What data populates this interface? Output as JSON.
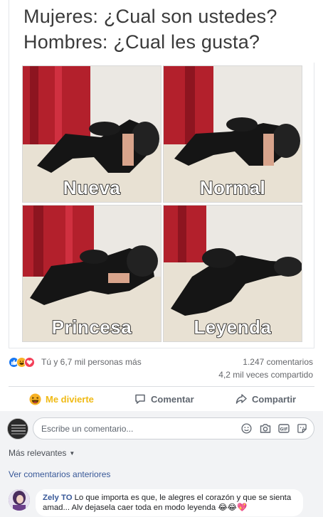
{
  "meme": {
    "line1": "Mujeres: ¿Cual son ustedes?",
    "line2": "Hombres: ¿Cual les gusta?",
    "panels": [
      {
        "label": "Nueva"
      },
      {
        "label": "Normal"
      },
      {
        "label": "Princesa"
      },
      {
        "label": "Leyenda"
      }
    ]
  },
  "reactions": {
    "icons": [
      "like-icon",
      "haha-icon",
      "love-icon"
    ],
    "reactors_text": "Tú y 6,7 mil personas más",
    "comments_count": "1.247 comentarios",
    "shares_count": "4,2 mil veces compartido"
  },
  "actions": {
    "react_label": "Me divierte",
    "comment_label": "Comentar",
    "share_label": "Compartir"
  },
  "composer": {
    "placeholder": "Escribe un comentario..."
  },
  "comments": {
    "sort_label": "Más relevantes",
    "previous_label": "Ver comentarios anteriores",
    "items": [
      {
        "author": "Zely TO",
        "text": "Lo que importa es que, le alegres el corazón y que se sienta amad... Alv dejasela caer toda en modo leyenda 😂😂💖"
      }
    ]
  },
  "colors": {
    "accent": "#1877f2",
    "link": "#385898",
    "react_active": "#f0ba15",
    "muted": "#65676b"
  }
}
